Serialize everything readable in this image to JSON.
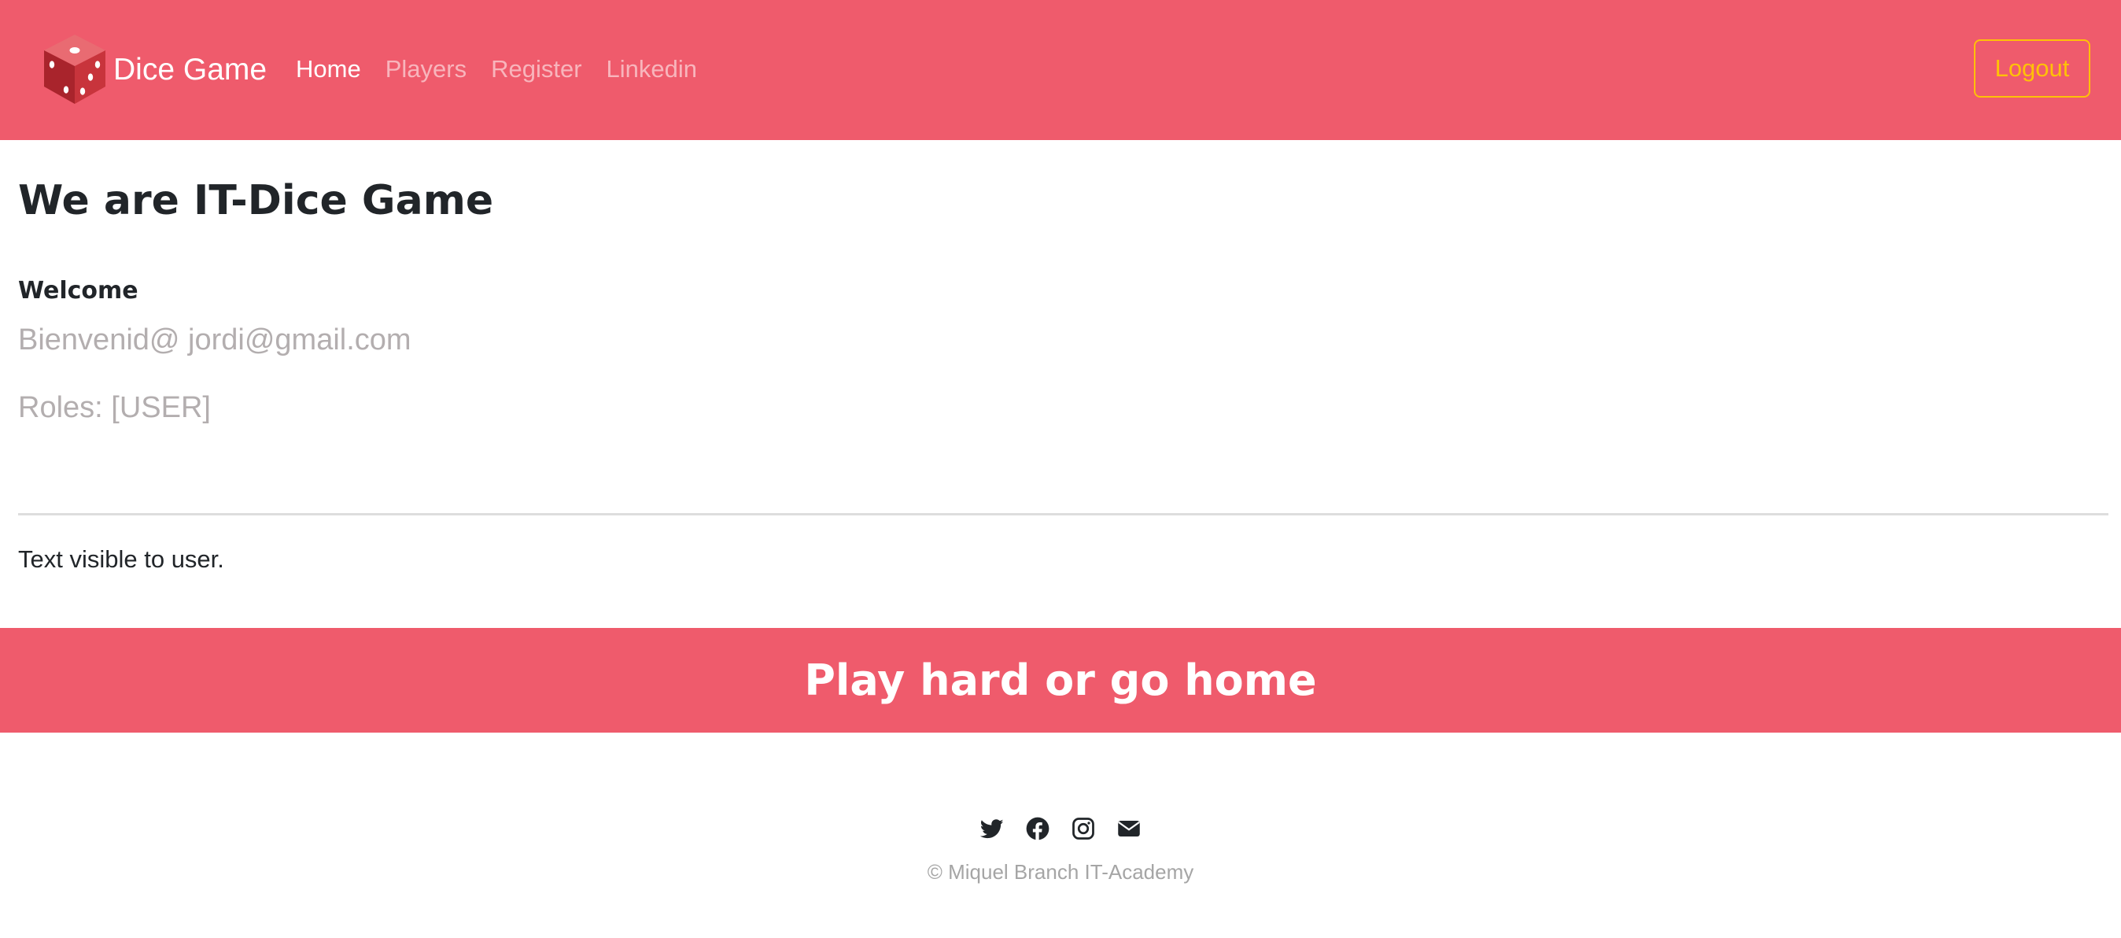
{
  "navbar": {
    "brand": {
      "logo_icon": "dice-icon",
      "text": "Dice Game"
    },
    "links": [
      {
        "label": "Home",
        "active": true
      },
      {
        "label": "Players",
        "active": false
      },
      {
        "label": "Register",
        "active": false
      },
      {
        "label": "Linkedin",
        "active": false
      }
    ],
    "logout_label": "Logout",
    "colors": {
      "background": "#ef5b6c",
      "logout_accent": "#ffc107"
    }
  },
  "main": {
    "title": "We are IT-Dice Game",
    "welcome_heading": "Welcome",
    "welcome_message": "Bienvenid@ jordi@gmail.com",
    "roles": "Roles: [USER]",
    "user_text": "Text visible to user."
  },
  "banner": {
    "text": "Play hard or go home",
    "color": "#ef5b6c"
  },
  "footer": {
    "social_icons": [
      "twitter-icon",
      "facebook-icon",
      "instagram-icon",
      "envelope-icon"
    ],
    "copyright": "© Miquel Branch IT-Academy"
  }
}
